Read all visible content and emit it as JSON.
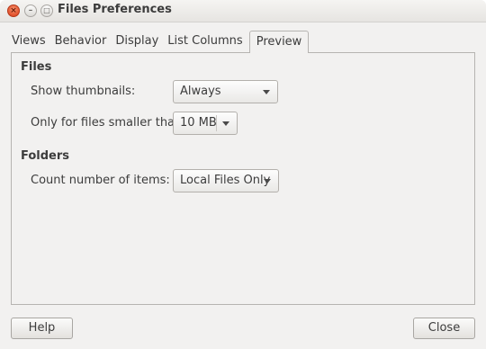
{
  "window": {
    "title": "Files Preferences"
  },
  "tabs": [
    {
      "label": "Views"
    },
    {
      "label": "Behavior"
    },
    {
      "label": "Display"
    },
    {
      "label": "List Columns"
    },
    {
      "label": "Preview"
    }
  ],
  "active_tab": "Preview",
  "files_section": {
    "heading": "Files",
    "show_thumbnails_label": "Show thumbnails:",
    "show_thumbnails_value": "Always",
    "size_limit_label": "Only for files smaller than:",
    "size_limit_value": "10 MB"
  },
  "folders_section": {
    "heading": "Folders",
    "count_items_label": "Count number of items:",
    "count_items_value": "Local Files Only"
  },
  "buttons": {
    "help": "Help",
    "close": "Close"
  },
  "window_controls": {
    "close_glyph": "×",
    "minimize_glyph": "–",
    "maximize_glyph": "□"
  }
}
